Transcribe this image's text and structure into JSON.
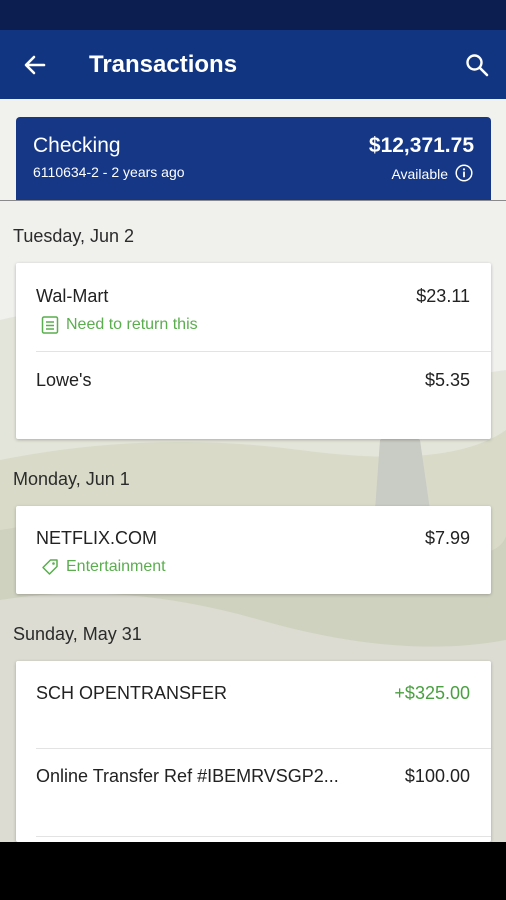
{
  "app_bar": {
    "title": "Transactions"
  },
  "account": {
    "name": "Checking",
    "meta": "6110634-2 - 2 years ago",
    "balance": "$12,371.75",
    "available_label": "Available"
  },
  "groups": [
    {
      "date": "Tuesday, Jun 2",
      "transactions": [
        {
          "name": "Wal-Mart",
          "amount": "$23.11",
          "tag": "Need to return this",
          "tag_icon": "note-icon"
        },
        {
          "name": "Lowe's",
          "amount": "$5.35"
        }
      ]
    },
    {
      "date": "Monday, Jun 1",
      "transactions": [
        {
          "name": "NETFLIX.COM",
          "amount": "$7.99",
          "tag": "Entertainment",
          "tag_icon": "tag-icon"
        }
      ]
    },
    {
      "date": "Sunday, May 31",
      "transactions": [
        {
          "name": "SCH OPENTRANSFER",
          "amount": "+$325.00"
        },
        {
          "name": "Online Transfer Ref #IBEMRVSGP2...",
          "amount": "$100.00"
        }
      ]
    }
  ],
  "colors": {
    "primary": "#123582",
    "status_bar": "#0c1e4f",
    "credit": "#4aa040",
    "tag": "#5aae4e"
  }
}
